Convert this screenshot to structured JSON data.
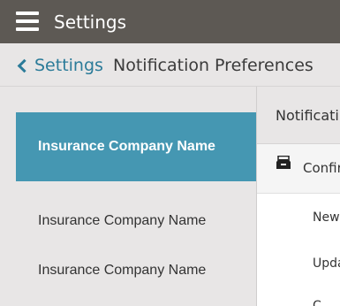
{
  "topbar": {
    "title": "Settings",
    "menu_icon": "hamburger-menu-icon"
  },
  "subheader": {
    "back_label": "Settings",
    "back_icon": "chevron-left-icon",
    "page_title": "Notification Preferences"
  },
  "sidebar": {
    "items": [
      {
        "label": "Insurance Company Name",
        "active": true
      },
      {
        "label": "Insurance Company Name",
        "active": false
      },
      {
        "label": "Insurance Company Name",
        "active": false
      }
    ]
  },
  "content": {
    "title": "Notificati",
    "group": {
      "icon": "inbox-tray-icon",
      "label": "Confir"
    },
    "sub_items": [
      "New",
      "Upda",
      "C"
    ]
  },
  "colors": {
    "topbar_bg": "#5d5954",
    "accent": "#4597b2",
    "link": "#2b7b99",
    "background": "#e8e6e6"
  }
}
